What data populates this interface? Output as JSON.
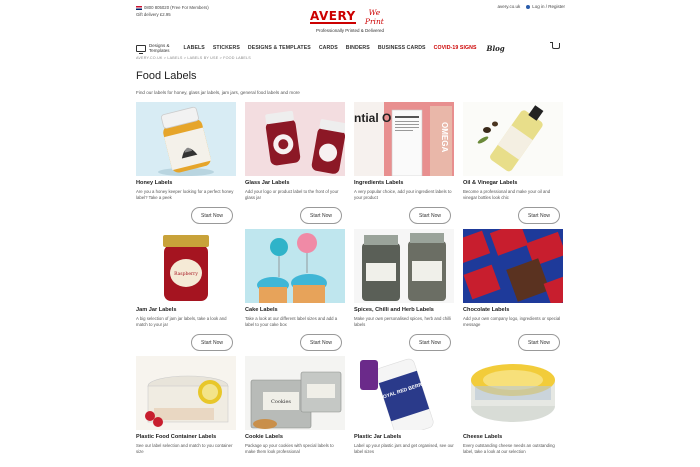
{
  "topbar": {
    "phone": "0800 805020",
    "phone_note": "(Free For Members)",
    "delivery": "Gift delivery £2.95",
    "domain": "avery.co.uk",
    "account": "Log in / Register"
  },
  "logo": {
    "brand": "AVERY",
    "weprint": "We Print",
    "tagline": "Professionally Printed & Delivered"
  },
  "nav": {
    "designs_line1": "Designs &",
    "designs_line2": "Templates",
    "items": [
      "LABELS",
      "STICKERS",
      "DESIGNS & TEMPLATES",
      "CARDS",
      "BINDERS",
      "BUSINESS CARDS",
      "COVID-19 SIGNS"
    ],
    "blog": "Blog"
  },
  "breadcrumb": "AVERY.CO.UK > LABELS > LABELS BY USE > FOOD LABELS",
  "page": {
    "title": "Food Labels",
    "intro": "Find our labels for honey, glass jar labels, jam jars, general food labels and more"
  },
  "cards": [
    {
      "title": "Honey Labels",
      "desc": "Are you a honey keeper looking for a perfect honey label? Take a peek",
      "button": "Start Now"
    },
    {
      "title": "Glass Jar Labels",
      "desc": "Add your logo or product label to the front of your glass jar",
      "button": "Start Now"
    },
    {
      "title": "Ingredients Labels",
      "desc": "A very popular choice, add your ingredient labels to your product",
      "button": "Start Now"
    },
    {
      "title": "Oil & Vinegar Labels",
      "desc": "Become a professional and make your oil and vinegar bottles look chic",
      "button": "Start Now"
    },
    {
      "title": "Jam Jar Labels",
      "desc": "A big selection of jam jar labels, take a look and match to your jar",
      "button": "Start Now"
    },
    {
      "title": "Cake Labels",
      "desc": "Take a look at our different label sizes and add a label to your cake box",
      "button": "Start Now"
    },
    {
      "title": "Spices, Chilli and Herb Labels",
      "desc": "Make your own personalised spices, herb and chilli labels",
      "button": "Start Now"
    },
    {
      "title": "Chocolate Labels",
      "desc": "Add your own company logo, ingredients or special message",
      "button": "Start Now"
    },
    {
      "title": "Plastic Food Container Labels",
      "desc": "See our label selection and match to you container size",
      "button": "Start Now"
    },
    {
      "title": "Cookie Labels",
      "desc": "Package up your cookies with special labels to make them look professional",
      "button": "Start Now"
    },
    {
      "title": "Plastic Jar Labels",
      "desc": "Label up your plastic jars and get organised, see our label sizes",
      "button": "Start Now"
    },
    {
      "title": "Cheese Labels",
      "desc": "Every outstanding cheese needs an outstanding label, take a look at our selection",
      "button": "Start Now"
    }
  ],
  "image_labels": {
    "ingredients_word": "ntial Oil",
    "ingredients_side": "OMEGA",
    "jam_label": "Raspberry",
    "plastic_jar": "ROYAL RED BERRY",
    "cookie_tin": "Cookies"
  }
}
